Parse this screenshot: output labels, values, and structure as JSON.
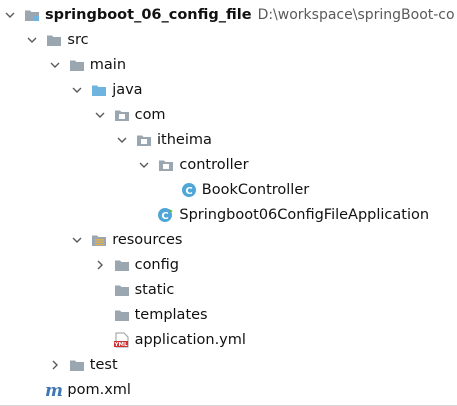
{
  "colors": {
    "folder": "#9aa7b0",
    "source_folder": "#6fb3e0",
    "class_icon": "#4fa6d8",
    "arrow": "#5a5a5a",
    "maven_m": "#3f77b5",
    "yml_label": "#cc3333"
  },
  "tree": [
    {
      "level": 0,
      "label": "springboot_06_config_file",
      "path": "D:\\workspace\\springBoot-co",
      "arrow": "down",
      "icon": "module-folder-icon",
      "bold": true
    },
    {
      "level": 1,
      "label": "src",
      "arrow": "down",
      "icon": "folder-icon"
    },
    {
      "level": 2,
      "label": "main",
      "arrow": "down",
      "icon": "folder-icon"
    },
    {
      "level": 3,
      "label": "java",
      "arrow": "down",
      "icon": "source-folder-icon"
    },
    {
      "level": 4,
      "label": "com",
      "arrow": "down",
      "icon": "package-icon"
    },
    {
      "level": 5,
      "label": "itheima",
      "arrow": "down",
      "icon": "package-icon"
    },
    {
      "level": 6,
      "label": "controller",
      "arrow": "down",
      "icon": "package-icon"
    },
    {
      "level": 7,
      "label": "BookController",
      "arrow": "none",
      "icon": "class-icon"
    },
    {
      "level": 6,
      "label": "Springboot06ConfigFileApplication",
      "arrow": "none",
      "icon": "spring-class-icon"
    },
    {
      "level": 3,
      "label": "resources",
      "arrow": "down",
      "icon": "resources-folder-icon"
    },
    {
      "level": 4,
      "label": "config",
      "arrow": "right",
      "icon": "folder-icon"
    },
    {
      "level": 4,
      "label": "static",
      "arrow": "none",
      "icon": "folder-icon"
    },
    {
      "level": 4,
      "label": "templates",
      "arrow": "none",
      "icon": "folder-icon"
    },
    {
      "level": 4,
      "label": "application.yml",
      "arrow": "none",
      "icon": "yml-file-icon"
    },
    {
      "level": 2,
      "label": "test",
      "arrow": "right",
      "icon": "folder-icon"
    },
    {
      "level": 1,
      "label": "pom.xml",
      "arrow": "none",
      "icon": "maven-icon"
    }
  ]
}
